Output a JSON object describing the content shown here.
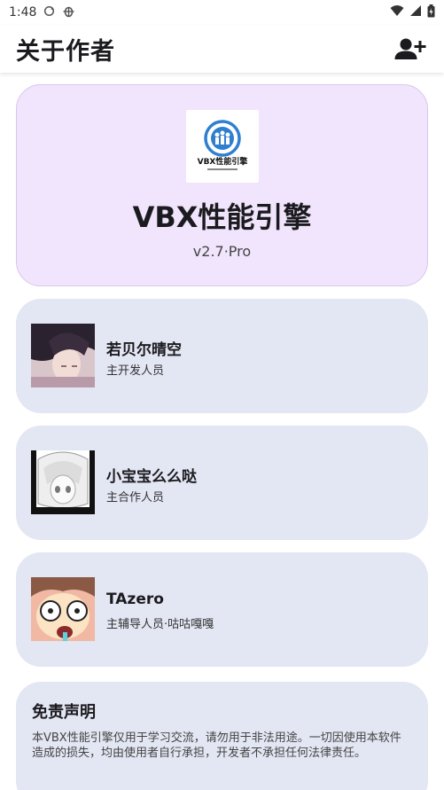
{
  "status_bar": {
    "time": "1:48",
    "icons": [
      "sync-icon",
      "bug-icon",
      "wifi-icon",
      "cellular-signal-icon",
      "battery-icon"
    ]
  },
  "app_bar": {
    "title": "关于作者",
    "action_icon": "add-user-icon"
  },
  "app_info": {
    "name": "VBX性能引擎",
    "version": "v2.7·Pro",
    "logo_text": "VBX性能引擎"
  },
  "authors": [
    {
      "name": "若贝尔晴空",
      "role": "主开发人员",
      "avatar": "dark-hair-avatar"
    },
    {
      "name": "小宝宝么么哒",
      "role": "主合作人员",
      "avatar": "sketch-avatar"
    },
    {
      "name": "TAzero",
      "role": "主辅导人员·咕咕嘎嘎",
      "avatar": "cartoon-avatar"
    }
  ],
  "disclaimer": {
    "title": "免责声明",
    "text": "本VBX性能引擎仅用于学习交流，请勿用于非法用途。一切因使用本软件造成的损失，均由使用者自行承担，开发者不承担任何法律责任。"
  },
  "colors": {
    "hero_card": "#f1e5fd",
    "author_card": "#e3e6f3",
    "app_bar": "#ffffff",
    "logo_blue": "#2f7fd0"
  }
}
